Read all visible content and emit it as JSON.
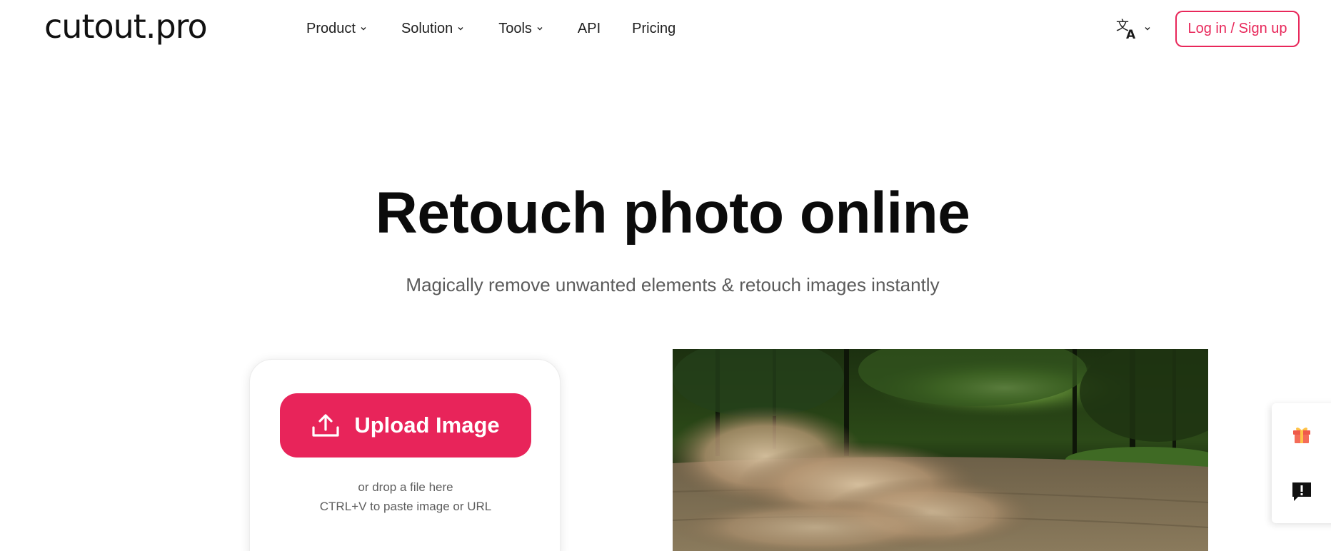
{
  "brand": {
    "logo_text": "cutout.pro",
    "accent_color": "#e8245a"
  },
  "nav": {
    "items": [
      {
        "label": "Product",
        "has_dropdown": true
      },
      {
        "label": "Solution",
        "has_dropdown": true
      },
      {
        "label": "Tools",
        "has_dropdown": true
      },
      {
        "label": "API",
        "has_dropdown": false
      },
      {
        "label": "Pricing",
        "has_dropdown": false
      }
    ],
    "language_icon": "translate-icon",
    "login_label": "Log in / Sign up"
  },
  "hero": {
    "title": "Retouch photo online",
    "subtitle": "Magically remove unwanted elements & retouch images instantly"
  },
  "upload": {
    "button_label": "Upload Image",
    "drop_hint": "or drop a file here",
    "paste_hint": "CTRL+V to paste image or URL"
  },
  "side_panel": {
    "icons": [
      "gift-icon",
      "feedback-icon"
    ]
  }
}
